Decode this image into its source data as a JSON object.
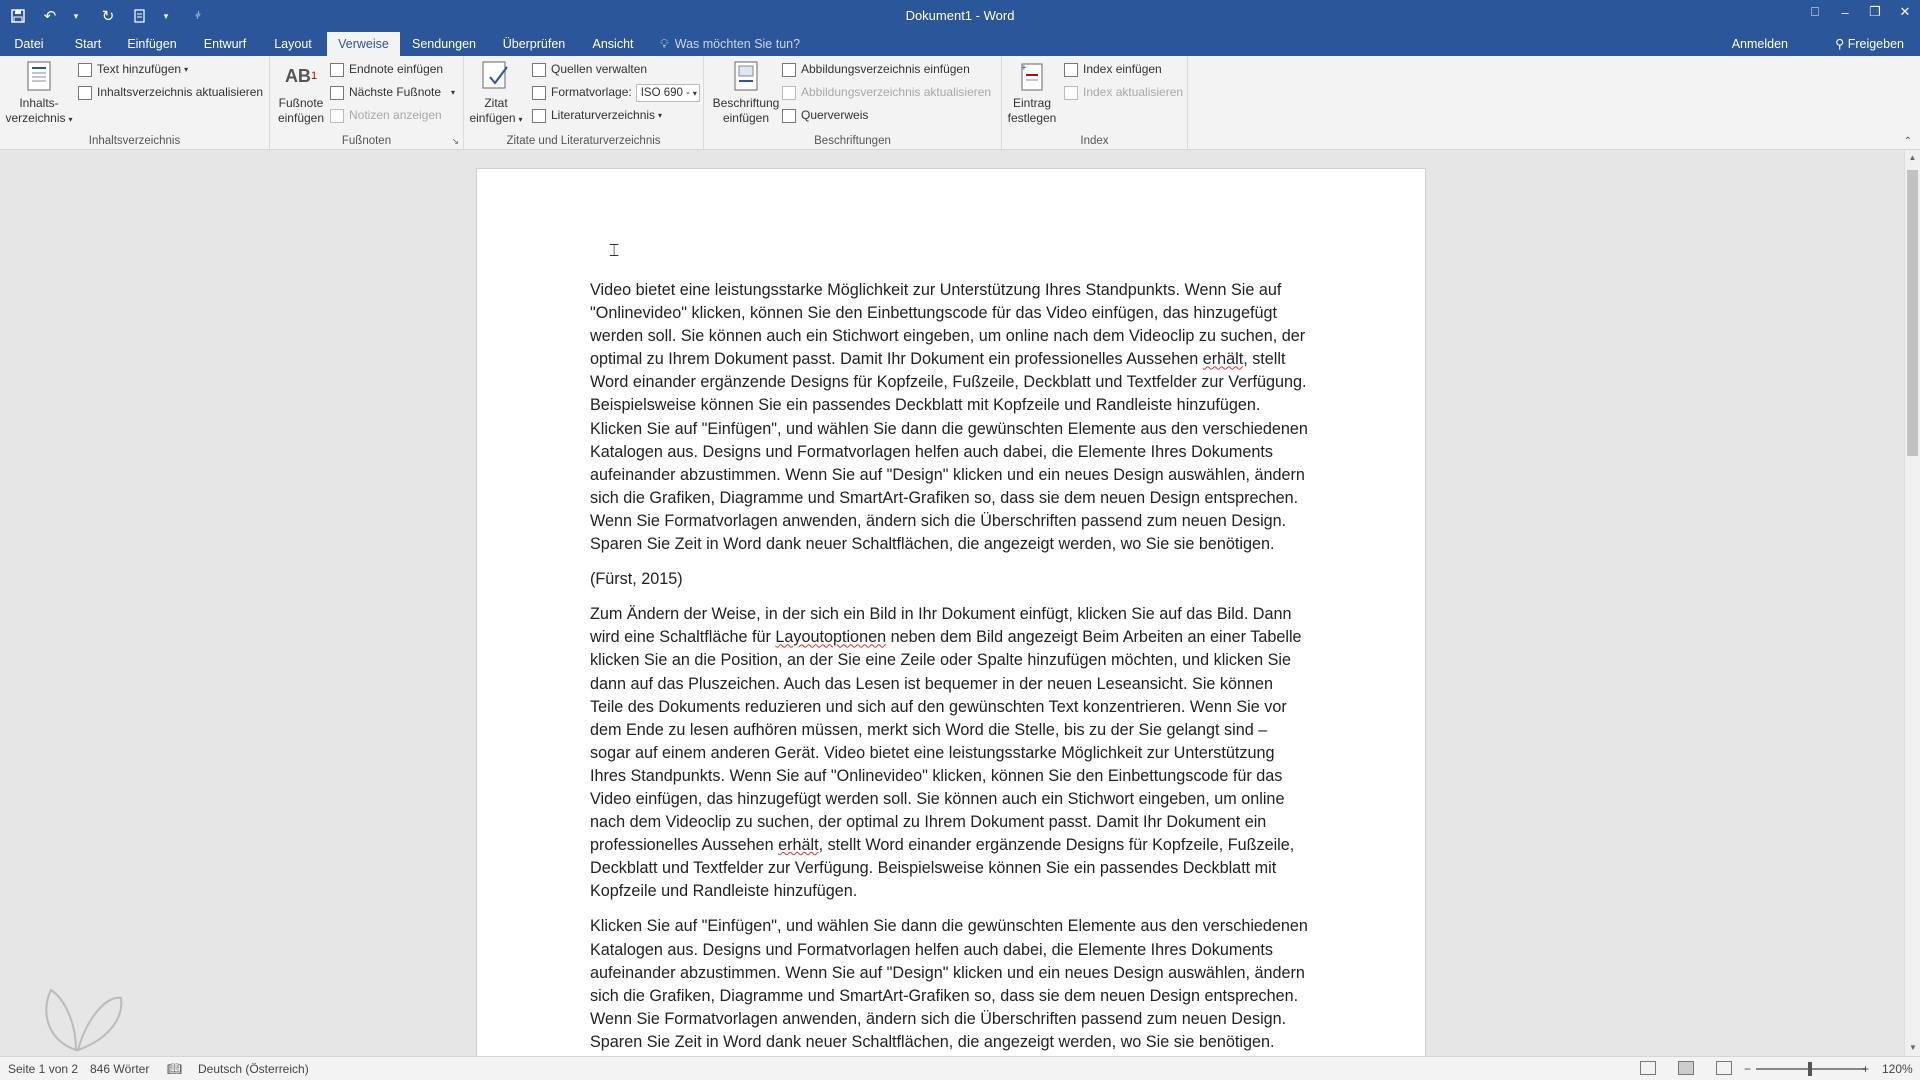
{
  "window": {
    "title": "Dokument1 - Word",
    "accent": "#2b579a",
    "qat": [
      "save-icon",
      "undo-icon",
      "redo-icon",
      "customize-icon"
    ]
  },
  "tabs": [
    {
      "label": "Datei"
    },
    {
      "label": "Start"
    },
    {
      "label": "Einfügen"
    },
    {
      "label": "Entwurf"
    },
    {
      "label": "Layout"
    },
    {
      "label": "Verweise",
      "active": true
    },
    {
      "label": "Sendungen"
    },
    {
      "label": "Überprüfen"
    },
    {
      "label": "Ansicht"
    }
  ],
  "tellme": "Was möchten Sie tun?",
  "account": {
    "signin": "Anmelden",
    "share": "Freigeben"
  },
  "ribbon": {
    "toc": {
      "label": "Inhaltsverzeichnis",
      "big_button": "Inhalts-",
      "big_button_2": "verzeichnis",
      "add_text": "Text hinzufügen",
      "update": "Inhaltsverzeichnis aktualisieren"
    },
    "footnotes": {
      "label": "Fußnoten",
      "big_button": "Fußnote",
      "big_button_2": "einfügen",
      "endnote": "Endnote einfügen",
      "next": "Nächste Fußnote",
      "show_notes": "Notizen anzeigen"
    },
    "citations": {
      "label": "Zitate und Literaturverzeichnis",
      "big_button": "Zitat",
      "big_button_2": "einfügen",
      "manage": "Quellen verwalten",
      "style_label": "Formatvorlage:",
      "style_value": "ISO 690 -",
      "bibliography": "Literaturverzeichnis"
    },
    "captions": {
      "label": "Beschriftungen",
      "big_button": "Beschriftung",
      "big_button_2": "einfügen",
      "insert_tof": "Abbildungsverzeichnis einfügen",
      "update_tof": "Abbildungsverzeichnis aktualisieren",
      "crossref": "Querverweis"
    },
    "index": {
      "label": "Index",
      "big_button": "Eintrag",
      "big_button_2": "festlegen",
      "insert": "Index einfügen",
      "update": "Index aktualisieren"
    }
  },
  "document": {
    "p1_a": "Video bietet eine leistungsstarke Möglichkeit zur Unterstützung Ihres Standpunkts. Wenn Sie auf \"Onlinevideo\" klicken, können Sie den Einbettungscode für das Video einfügen, das hinzugefügt werden soll. Sie können auch ein Stichwort eingeben, um online nach dem Videoclip zu suchen, der optimal zu Ihrem Dokument passt. Damit Ihr Dokument ein professionelles Aussehen ",
    "p1_err": "erhält",
    "p1_b": ", stellt Word einander ergänzende Designs für Kopfzeile, Fußzeile, Deckblatt und Textfelder zur Verfügung. Beispielsweise können Sie ein passendes Deckblatt mit Kopfzeile und Randleiste hinzufügen. Klicken Sie auf \"Einfügen\", und wählen Sie dann die gewünschten Elemente aus den verschiedenen Katalogen aus. Designs und Formatvorlagen helfen auch dabei, die Elemente Ihres Dokuments aufeinander abzustimmen. Wenn Sie auf \"Design\" klicken und ein neues Design auswählen, ändern sich die Grafiken, Diagramme und SmartArt-Grafiken so, dass sie dem neuen Design entsprechen. Wenn Sie Formatvorlagen anwenden, ändern sich die Überschriften passend zum neuen Design. Sparen Sie Zeit in Word dank neuer Schaltflächen, die angezeigt werden, wo Sie sie benötigen.",
    "citation": "(Fürst, 2015)",
    "p2_a": "Zum Ändern der Weise, in der sich ein Bild in Ihr Dokument einfügt, klicken Sie auf das Bild. Dann wird eine Schaltfläche für ",
    "p2_err1": "Layoutoptionen",
    "p2_b": " neben dem Bild angezeigt Beim Arbeiten an einer Tabelle klicken Sie an die Position, an der Sie eine Zeile oder Spalte hinzufügen möchten, und klicken Sie dann auf das Pluszeichen. Auch das Lesen ist bequemer in der neuen Leseansicht. Sie können Teile des Dokuments reduzieren und sich auf den gewünschten Text konzentrieren. Wenn Sie vor dem Ende zu lesen aufhören müssen, merkt sich Word die Stelle, bis zu der Sie gelangt sind – sogar auf einem anderen Gerät. Video bietet eine leistungsstarke Möglichkeit zur Unterstützung Ihres Standpunkts. Wenn Sie auf \"Onlinevideo\" klicken, können Sie den Einbettungscode für das Video einfügen, das hinzugefügt werden soll. Sie können auch ein Stichwort eingeben, um online nach dem Videoclip zu suchen, der optimal zu Ihrem Dokument passt. Damit Ihr Dokument ein professionelles Aussehen ",
    "p2_err2": "erhält",
    "p2_c": ", stellt Word einander ergänzende Designs für Kopfzeile, Fußzeile, Deckblatt und Textfelder zur Verfügung. Beispielsweise können Sie ein passendes Deckblatt mit Kopfzeile und Randleiste hinzufügen.",
    "p3": "Klicken Sie auf \"Einfügen\", und wählen Sie dann die gewünschten Elemente aus den verschiedenen Katalogen aus. Designs und Formatvorlagen helfen auch dabei, die Elemente Ihres Dokuments aufeinander abzustimmen. Wenn Sie auf \"Design\" klicken und ein neues Design auswählen, ändern sich die Grafiken, Diagramme und SmartArt-Grafiken so, dass sie dem neuen Design entsprechen. Wenn Sie Formatvorlagen anwenden, ändern sich die Überschriften passend zum neuen Design. Sparen Sie Zeit in Word dank neuer Schaltflächen, die angezeigt werden, wo Sie sie benötigen. Zum"
  },
  "status": {
    "page": "Seite 1 von 2",
    "words": "846 Wörter",
    "language": "Deutsch (Österreich)",
    "zoom": "120%"
  }
}
